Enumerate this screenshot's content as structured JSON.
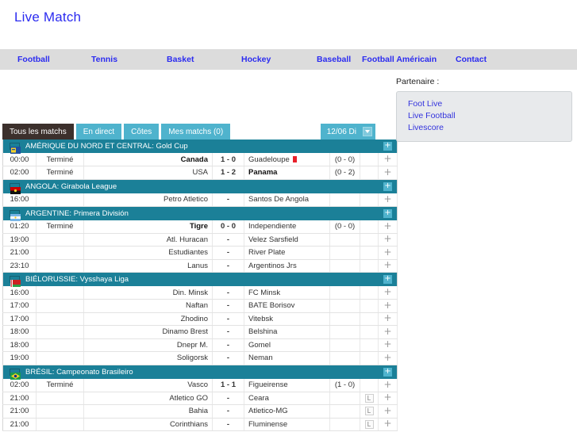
{
  "header": {
    "title": "Live Match"
  },
  "nav": {
    "items": [
      {
        "label": "Football",
        "name": "nav-football"
      },
      {
        "label": "Tennis",
        "name": "nav-tennis"
      },
      {
        "label": "Basket",
        "name": "nav-basket"
      },
      {
        "label": "Hockey",
        "name": "nav-hockey"
      },
      {
        "label": "Baseball",
        "name": "nav-baseball"
      },
      {
        "label": "Football Américain",
        "name": "nav-football-americain"
      },
      {
        "label": "Contact",
        "name": "nav-contact"
      }
    ]
  },
  "sidebar": {
    "partner_label": "Partenaire :",
    "links": [
      {
        "label": "Foot Live"
      },
      {
        "label": "Live Football"
      },
      {
        "label": "Livescore"
      }
    ]
  },
  "toolbar": {
    "tabs": [
      {
        "label": "Tous les matchs",
        "active": true
      },
      {
        "label": "En direct",
        "active": false
      },
      {
        "label": "Côtes",
        "active": false
      },
      {
        "label": "Mes matchs (0)",
        "active": false
      }
    ],
    "date": "12/06 Di",
    "date_arrow_icon": "chevron-down-icon"
  },
  "colors": {
    "accent_teal": "#4fb3cd",
    "league_header": "#1b8098",
    "active_tab": "#3c302c",
    "link_blue": "#2b2bf0",
    "nav_bg": "#dcdcdc",
    "red_card": "#e8202a"
  },
  "leagues": [
    {
      "name": "AMÉRIQUE DU NORD ET CENTRAL: Gold Cup",
      "flag": "flag-concacaf",
      "expand_icon": "plus-icon",
      "matches": [
        {
          "time": "00:00",
          "status": "Terminé",
          "home": "Canada",
          "home_bold": true,
          "score": "1 - 0",
          "away": "Guadeloupe",
          "away_bold": false,
          "away_redcard": true,
          "half": "(0 - 0)",
          "l": false
        },
        {
          "time": "02:00",
          "status": "Terminé",
          "home": "USA",
          "home_bold": false,
          "score": "1 - 2",
          "away": "Panama",
          "away_bold": true,
          "away_redcard": false,
          "half": "(0 - 2)",
          "l": false
        }
      ]
    },
    {
      "name": "ANGOLA: Girabola League",
      "flag": "flag-angola",
      "expand_icon": "plus-icon",
      "matches": [
        {
          "time": "16:00",
          "status": "",
          "home": "Petro Atletico",
          "home_bold": false,
          "score": "-",
          "away": "Santos De Angola",
          "away_bold": false,
          "away_redcard": false,
          "half": "",
          "l": false
        }
      ]
    },
    {
      "name": "ARGENTINE: Primera División",
      "flag": "flag-argentina",
      "expand_icon": "plus-icon",
      "matches": [
        {
          "time": "01:20",
          "status": "Terminé",
          "home": "Tigre",
          "home_bold": true,
          "score": "0 - 0",
          "away": "Independiente",
          "away_bold": false,
          "away_redcard": false,
          "half": "(0 - 0)",
          "l": false
        },
        {
          "time": "19:00",
          "status": "",
          "home": "Atl. Huracan",
          "home_bold": false,
          "score": "-",
          "away": "Velez Sarsfield",
          "away_bold": false,
          "away_redcard": false,
          "half": "",
          "l": false
        },
        {
          "time": "21:00",
          "status": "",
          "home": "Estudiantes",
          "home_bold": false,
          "score": "-",
          "away": "River Plate",
          "away_bold": false,
          "away_redcard": false,
          "half": "",
          "l": false
        },
        {
          "time": "23:10",
          "status": "",
          "home": "Lanus",
          "home_bold": false,
          "score": "-",
          "away": "Argentinos Jrs",
          "away_bold": false,
          "away_redcard": false,
          "half": "",
          "l": false
        }
      ]
    },
    {
      "name": "BIÉLORUSSIE: Vysshaya Liga",
      "flag": "flag-belarus",
      "expand_icon": "plus-icon",
      "matches": [
        {
          "time": "16:00",
          "status": "",
          "home": "Din. Minsk",
          "home_bold": false,
          "score": "-",
          "away": "FC Minsk",
          "away_bold": false,
          "away_redcard": false,
          "half": "",
          "l": false
        },
        {
          "time": "17:00",
          "status": "",
          "home": "Naftan",
          "home_bold": false,
          "score": "-",
          "away": "BATE Borisov",
          "away_bold": false,
          "away_redcard": false,
          "half": "",
          "l": false
        },
        {
          "time": "17:00",
          "status": "",
          "home": "Zhodino",
          "home_bold": false,
          "score": "-",
          "away": "Vitebsk",
          "away_bold": false,
          "away_redcard": false,
          "half": "",
          "l": false
        },
        {
          "time": "18:00",
          "status": "",
          "home": "Dinamo Brest",
          "home_bold": false,
          "score": "-",
          "away": "Belshina",
          "away_bold": false,
          "away_redcard": false,
          "half": "",
          "l": false
        },
        {
          "time": "18:00",
          "status": "",
          "home": "Dnepr M.",
          "home_bold": false,
          "score": "-",
          "away": "Gomel",
          "away_bold": false,
          "away_redcard": false,
          "half": "",
          "l": false
        },
        {
          "time": "19:00",
          "status": "",
          "home": "Soligorsk",
          "home_bold": false,
          "score": "-",
          "away": "Neman",
          "away_bold": false,
          "away_redcard": false,
          "half": "",
          "l": false
        }
      ]
    },
    {
      "name": "BRÉSIL: Campeonato Brasileiro",
      "flag": "flag-brazil",
      "expand_icon": "plus-icon",
      "matches": [
        {
          "time": "02:00",
          "status": "Terminé",
          "home": "Vasco",
          "home_bold": false,
          "score": "1 - 1",
          "away": "Figueirense",
          "away_bold": false,
          "away_redcard": false,
          "half": "(1 - 0)",
          "l": false
        },
        {
          "time": "21:00",
          "status": "",
          "home": "Atletico GO",
          "home_bold": false,
          "score": "-",
          "away": "Ceara",
          "away_bold": false,
          "away_redcard": false,
          "half": "",
          "l": true
        },
        {
          "time": "21:00",
          "status": "",
          "home": "Bahia",
          "home_bold": false,
          "score": "-",
          "away": "Atletico-MG",
          "away_bold": false,
          "away_redcard": false,
          "half": "",
          "l": true
        },
        {
          "time": "21:00",
          "status": "",
          "home": "Corinthians",
          "home_bold": false,
          "score": "-",
          "away": "Fluminense",
          "away_bold": false,
          "away_redcard": false,
          "half": "",
          "l": true
        }
      ]
    }
  ],
  "row_labels": {
    "l_badge": "L",
    "plus": "+"
  }
}
